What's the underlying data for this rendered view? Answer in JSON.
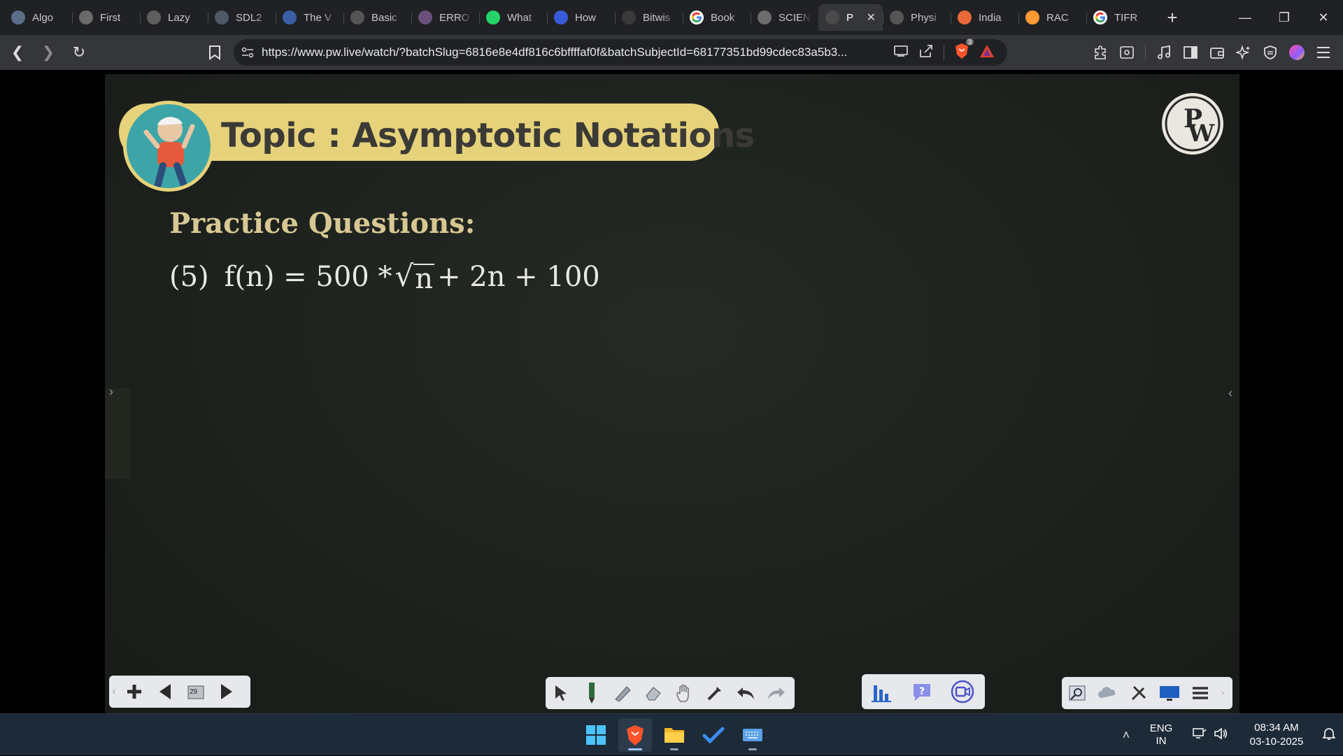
{
  "tabs": [
    {
      "label": "Algo",
      "icon": "algo-tab-icon",
      "color": "#5b6f8a"
    },
    {
      "label": "First",
      "icon": "first-tab-icon",
      "color": "#6a6a6a"
    },
    {
      "label": "Lazy",
      "icon": "lazy-tab-icon",
      "color": "#5e5e5e"
    },
    {
      "label": "SDL2",
      "icon": "sdl2-tab-icon",
      "color": "#4f5866"
    },
    {
      "label": "The V",
      "icon": "the-v-tab-icon",
      "color": "#3b5ea6"
    },
    {
      "label": "Basic",
      "icon": "basic-tab-icon",
      "color": "#555555"
    },
    {
      "label": "ERRO",
      "icon": "erro-tab-icon",
      "color": "#6a4f7a"
    },
    {
      "label": "What",
      "icon": "whatsapp-tab-icon",
      "color": "#25d366"
    },
    {
      "label": "How",
      "icon": "how-tab-icon",
      "color": "#3a5bd9"
    },
    {
      "label": "Bitwis",
      "icon": "bitwise-tab-icon",
      "color": "#3a3a3a"
    },
    {
      "label": "Book",
      "icon": "google-tab-icon",
      "color": "#ffffff"
    },
    {
      "label": "SCIEN",
      "icon": "scien-tab-icon",
      "color": "#6c6c6c"
    },
    {
      "label": "P",
      "icon": "pw-tab-icon",
      "color": "#4a4a4a",
      "active": true
    },
    {
      "label": "Physi",
      "icon": "physi-tab-icon",
      "color": "#555555"
    },
    {
      "label": "India",
      "icon": "india-tab-icon",
      "color": "#e86a3a"
    },
    {
      "label": "RAC",
      "icon": "rac-tab-icon",
      "color": "#ff9933"
    },
    {
      "label": "TIFR",
      "icon": "google-tab-icon",
      "color": "#ffffff"
    }
  ],
  "address_bar": {
    "url": "https://www.pw.live/watch/?batchSlug=6816e8e4df816c6bffffaf0f&batchSubjectId=68177351bd99cdec83a5b3...",
    "brave_shield_count": "3"
  },
  "lecture": {
    "topic": "Topic : Asymptotic Notations",
    "section_heading": "Practice Questions:",
    "question_number": "(5)",
    "question_lhs": "f(n) = 500 *",
    "question_radicand": "n",
    "question_rhs": "+ 2n + 100",
    "logo_text": "PW",
    "page_indicator": "29"
  },
  "taskbar": {
    "language_line1": "ENG",
    "language_line2": "IN",
    "time": "08:34 AM",
    "date": "03-10-2025"
  },
  "colors": {
    "topic_pill": "#e6d27a",
    "board": "#1e221e",
    "practice_heading": "#d7c792",
    "taskbar": "#1d2a38"
  }
}
